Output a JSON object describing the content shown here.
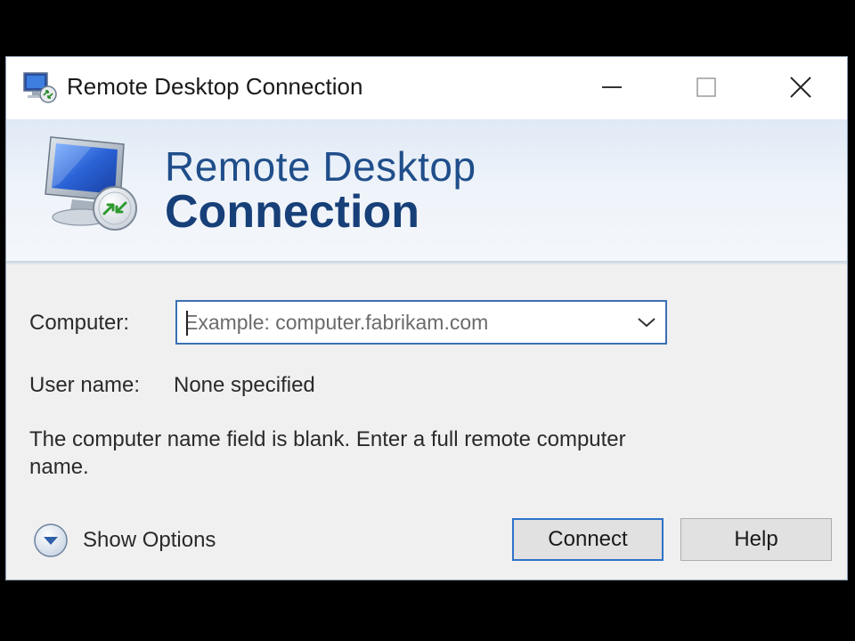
{
  "window": {
    "title": "Remote Desktop Connection",
    "icon": "remote-desktop-icon",
    "controls": {
      "minimize": "minimize-icon",
      "maximize": "maximize-icon",
      "close": "close-icon"
    }
  },
  "banner": {
    "line1": "Remote Desktop",
    "line2": "Connection",
    "icon": "monitor-connection-icon"
  },
  "form": {
    "computer_label": "Computer:",
    "computer_value": "",
    "computer_placeholder": "Example: computer.fabrikam.com",
    "username_label": "User name:",
    "username_value": "None specified"
  },
  "message": "The computer name field is blank. Enter a full remote computer name.",
  "footer": {
    "show_options_label": "Show Options",
    "connect_label": "Connect",
    "help_label": "Help"
  },
  "colors": {
    "banner_text": "#1f4e8a",
    "focus_border": "#2f73c8",
    "window_background": "#f0f0f0"
  }
}
